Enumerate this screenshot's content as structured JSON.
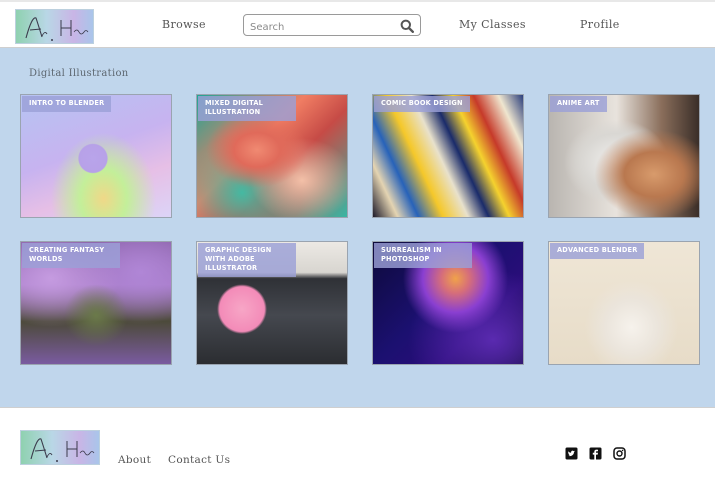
{
  "header": {
    "logo_text": "Art Haus",
    "nav": {
      "browse": "Browse",
      "my_classes": "My Classes",
      "profile": "Profile"
    },
    "search": {
      "placeholder": "Search",
      "icon": "search-icon"
    }
  },
  "main": {
    "section_title": "Digital Illustration",
    "cards": [
      {
        "label": "Intro to Blender"
      },
      {
        "label": "Mixed Digital Illustration"
      },
      {
        "label": "Comic Book Design"
      },
      {
        "label": "Anime Art"
      },
      {
        "label": "Creating Fantasy Worlds"
      },
      {
        "label": "Graphic Design with Adobe Illustrator"
      },
      {
        "label": "Surrealism in Photoshop"
      },
      {
        "label": "Advanced Blender"
      }
    ]
  },
  "footer": {
    "logo_text": "Art Haus",
    "links": {
      "about": "About",
      "contact": "Contact Us"
    },
    "social": [
      "twitter-icon",
      "facebook-icon",
      "instagram-icon"
    ]
  },
  "colors": {
    "main_background": "#c0d6ec",
    "card_label_background": "#9ba0d7"
  }
}
